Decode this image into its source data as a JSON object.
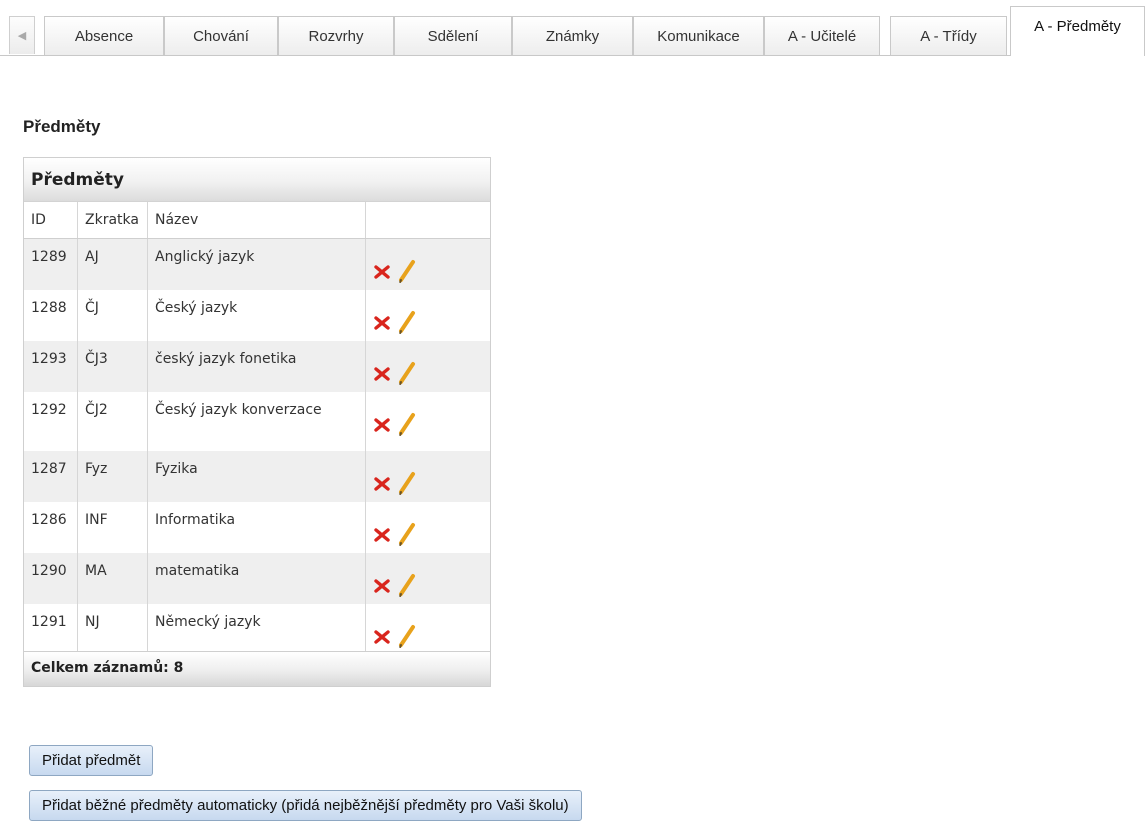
{
  "tabs": [
    {
      "label": "Absence",
      "active": false
    },
    {
      "label": "Chování",
      "active": false
    },
    {
      "label": "Rozvrhy",
      "active": false
    },
    {
      "label": "Sdělení",
      "active": false
    },
    {
      "label": "Známky",
      "active": false
    },
    {
      "label": "Komunikace",
      "active": false
    },
    {
      "label": "A - Učitelé",
      "active": false
    },
    {
      "label": "A - Třídy",
      "active": false
    },
    {
      "label": "A - Předměty",
      "active": true
    }
  ],
  "tab_scroll_icon": "chevron-left-icon",
  "page_title": "Předměty",
  "grid": {
    "title": "Předměty",
    "columns": [
      "ID",
      "Zkratka",
      "Název",
      ""
    ],
    "rows": [
      {
        "id": "1289",
        "abbr": "AJ",
        "name": "Anglický jazyk"
      },
      {
        "id": "1288",
        "abbr": "ČJ",
        "name": "Český jazyk"
      },
      {
        "id": "1293",
        "abbr": "ČJ3",
        "name": "český jazyk fonetika"
      },
      {
        "id": "1292",
        "abbr": "ČJ2",
        "name": "Český jazyk konverzace"
      },
      {
        "id": "1287",
        "abbr": "Fyz",
        "name": "Fyzika"
      },
      {
        "id": "1286",
        "abbr": "INF",
        "name": "Informatika"
      },
      {
        "id": "1290",
        "abbr": "MA",
        "name": "matematika"
      },
      {
        "id": "1291",
        "abbr": "NJ",
        "name": "Německý jazyk"
      }
    ],
    "row_actions": [
      "delete-icon",
      "edit-icon"
    ],
    "footer": "Celkem záznamů: 8"
  },
  "buttons": {
    "add_subject": "Přidat předmět",
    "add_common_subjects": "Přidat běžné předměty automaticky (přidá nejběžnější předměty pro Vaši školu)"
  },
  "colors": {
    "delete": "#d9251d",
    "edit": "#e8a21c",
    "button_border": "#8ea7c2"
  }
}
